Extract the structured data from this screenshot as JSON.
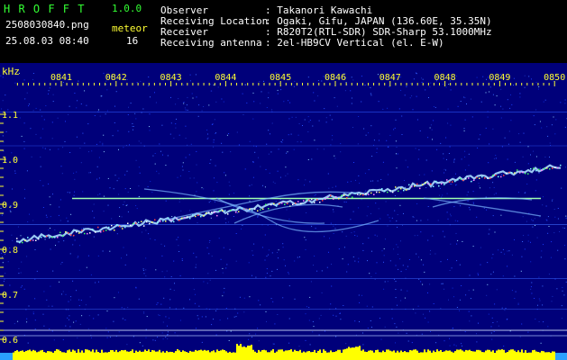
{
  "app": {
    "name": "H R O F F T",
    "version": "1.0.0",
    "filename": "2508030840.png",
    "datetime": "25.08.03 08:40",
    "count_label": "meteor",
    "count_value": "16"
  },
  "info": {
    "labels": [
      "Observer",
      "Receiving Location",
      "Receiver",
      "Receiving antenna"
    ],
    "values": [
      ": Takanori Kawachi",
      ": Ogaki, Gifu, JAPAN (136.60E, 35.35N)",
      ": R820T2(RTL-SDR) SDR-Sharp 53.1000MHz",
      ": 2el-HB9CV Vertical (el. E-W)"
    ]
  },
  "chart_data": {
    "type": "heatmap",
    "title": "",
    "ylabel": "kHz",
    "yticks": [
      "1.1",
      "1.0",
      "0.9",
      "0.8",
      "0.7",
      "0.6"
    ],
    "xticks": [
      "0841",
      "0842",
      "0843",
      "0844",
      "0845",
      "0846",
      "0847",
      "0848",
      "0849",
      "0850"
    ],
    "ylim": [
      0.58,
      1.18
    ],
    "colors": {
      "background": "#00007a",
      "tick_color": "#ffff33",
      "trace": "#aaddff",
      "carrier": "#9fffb0",
      "level": "#ffff00"
    }
  }
}
